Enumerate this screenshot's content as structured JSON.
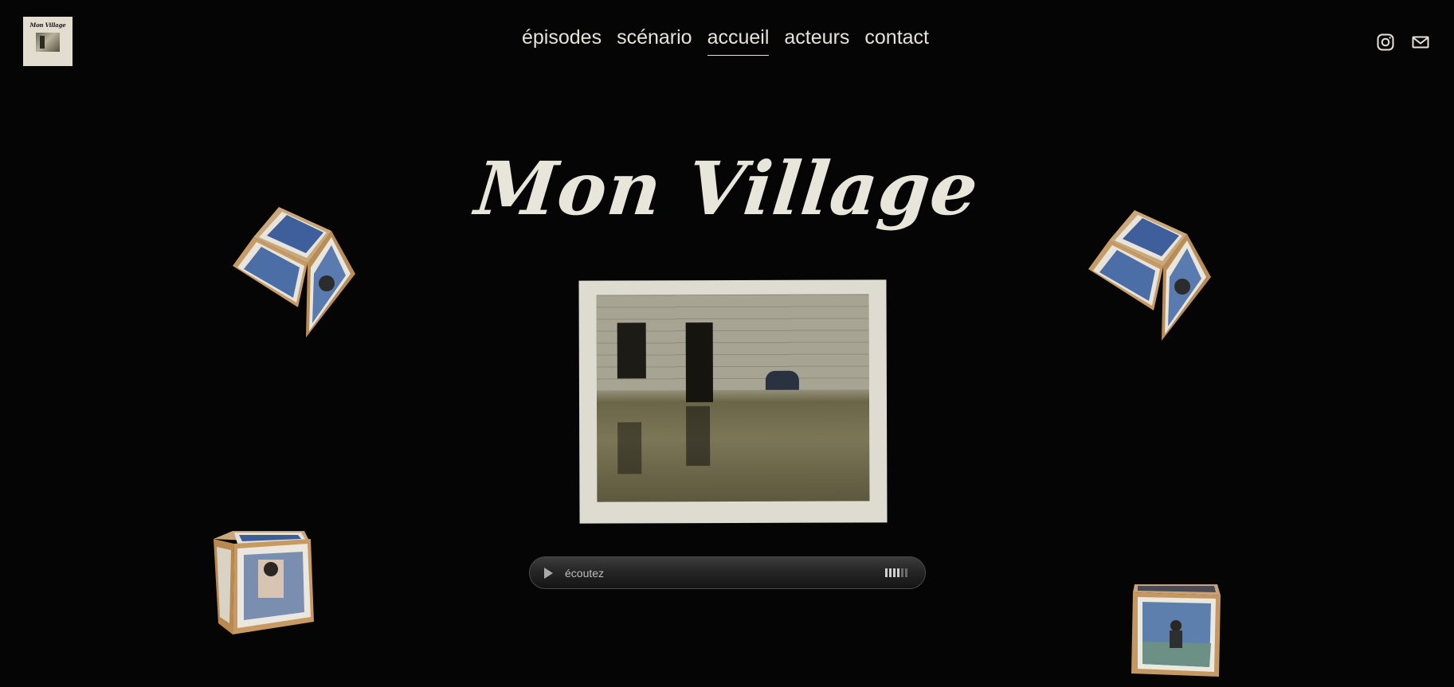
{
  "logo": {
    "text": "Mon Village"
  },
  "nav": {
    "items": [
      {
        "label": "épisodes"
      },
      {
        "label": "scénario"
      },
      {
        "label": "accueil",
        "active": true
      },
      {
        "label": "acteurs"
      },
      {
        "label": "contact"
      }
    ]
  },
  "social": {
    "icons": [
      "instagram-icon",
      "mail-icon"
    ]
  },
  "hero": {
    "title": "Mon Village"
  },
  "player": {
    "label": "écoutez",
    "volume_level": 0.67
  },
  "colors": {
    "background": "#050505",
    "text": "#e8e5da",
    "frame": "#dedbd0"
  }
}
